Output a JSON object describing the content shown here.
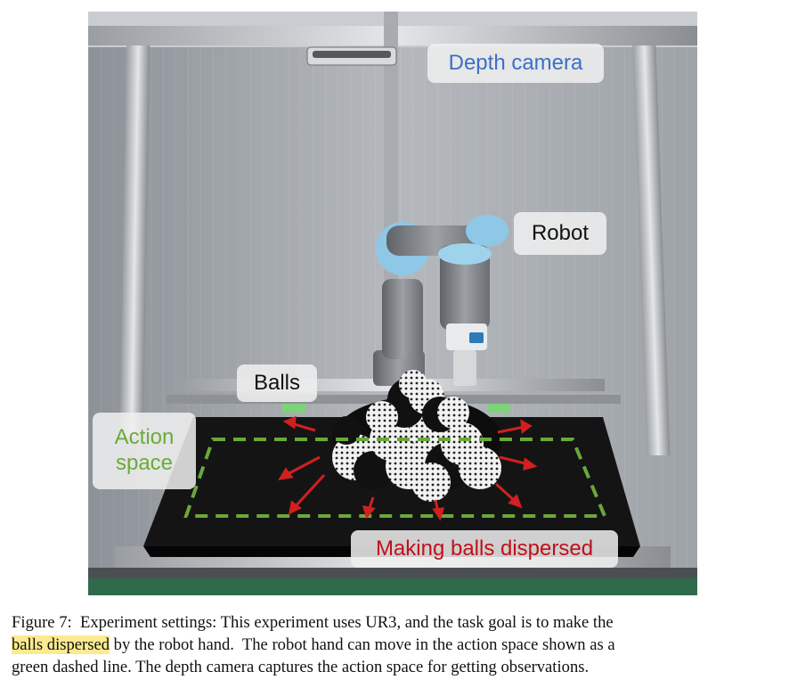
{
  "figure": {
    "labels": {
      "depth_camera": "Depth camera",
      "robot": "Robot",
      "balls": "Balls",
      "action_line1": "Action",
      "action_line2": "space",
      "dispersed": "Making balls dispersed"
    },
    "colors": {
      "camera_label": "#3c6fc7",
      "action_label": "#6aab3a",
      "dispersed_label": "#c0101a",
      "dashed_line": "#6aa83a",
      "arrows": "#d02020",
      "robot_accent": "#8ec8e6"
    }
  },
  "caption": {
    "prefix": "Figure 7:",
    "line1_rest": "  Experiment settings: This experiment uses UR3, and the task goal is to make the",
    "highlight": "balls dispersed",
    "line2_rest": " by the robot hand.  The robot hand can move in the action space shown as a",
    "line3": "green dashed line.  The depth camera captures the action space for getting observations.",
    "highlight_color": "#fbeb8e"
  }
}
